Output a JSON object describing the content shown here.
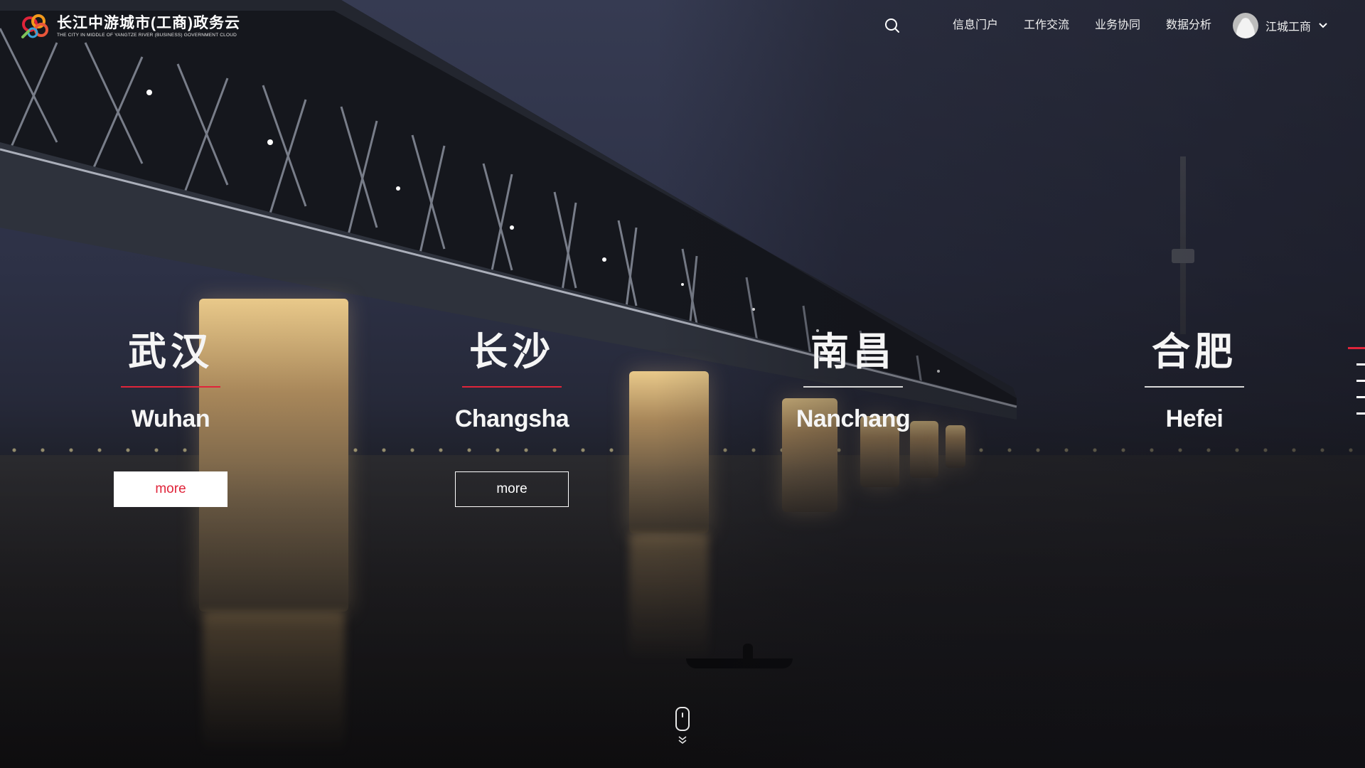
{
  "header": {
    "logo_title": "长江中游城市(工商)政务云",
    "logo_subtitle": "THE CITY IN MIDDLE OF YANGTZE RIVER (BUSINESS) GOVERNMENT CLOUD",
    "search_icon": "search-icon",
    "nav": [
      {
        "label": "信息门户"
      },
      {
        "label": "工作交流"
      },
      {
        "label": "业务协同"
      },
      {
        "label": "数据分析"
      }
    ],
    "user": {
      "name": "江城工商",
      "avatar": "avatar-icon",
      "dropdown_icon": "chevron-down-icon"
    }
  },
  "cities": [
    {
      "cn": "武汉",
      "en": "Wuhan",
      "button": "more",
      "active": true
    },
    {
      "cn": "长沙",
      "en": "Changsha",
      "button": "more",
      "active": true
    },
    {
      "cn": "南昌",
      "en": "Nanchang",
      "active": false
    },
    {
      "cn": "合肥",
      "en": "Hefei",
      "active": false
    }
  ],
  "pager": {
    "count": 5,
    "active_index": 0
  },
  "colors": {
    "accent": "#e0243a",
    "text": "#ffffff",
    "button_bg": "#ffffff"
  },
  "scroll_hint": {
    "icon": "mouse-scroll-icon",
    "arrow_icon": "double-chevron-down-icon"
  }
}
